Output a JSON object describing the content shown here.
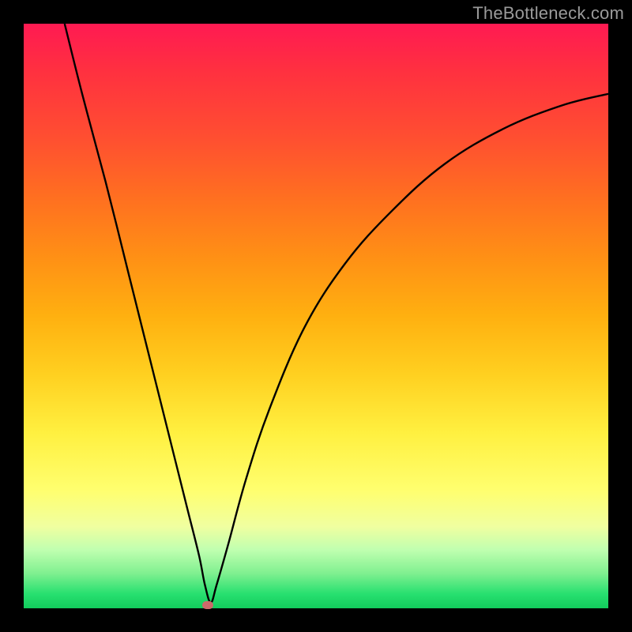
{
  "watermark": "TheBottleneck.com",
  "chart_data": {
    "type": "line",
    "title": "",
    "xlabel": "",
    "ylabel": "",
    "xlim": [
      0,
      100
    ],
    "ylim": [
      0,
      100
    ],
    "grid": false,
    "series": [
      {
        "name": "bottleneck-curve",
        "x": [
          7,
          10,
          14,
          18,
          22,
          26,
          28,
          30,
          31,
          32,
          33,
          35,
          38,
          42,
          48,
          55,
          63,
          72,
          82,
          92,
          100
        ],
        "y": [
          100,
          88,
          73,
          57,
          41,
          25,
          17,
          9,
          4,
          1,
          4,
          11,
          22,
          34,
          48,
          59,
          68,
          76,
          82,
          86,
          88
        ]
      }
    ],
    "marker": {
      "x": 31.5,
      "y": 0.5,
      "color": "#cc6a6a"
    },
    "gradient_stops": [
      {
        "pct": 0,
        "color": "#ff1a52"
      },
      {
        "pct": 50,
        "color": "#ffb010"
      },
      {
        "pct": 80,
        "color": "#ffff70"
      },
      {
        "pct": 100,
        "color": "#12cc5c"
      }
    ]
  }
}
